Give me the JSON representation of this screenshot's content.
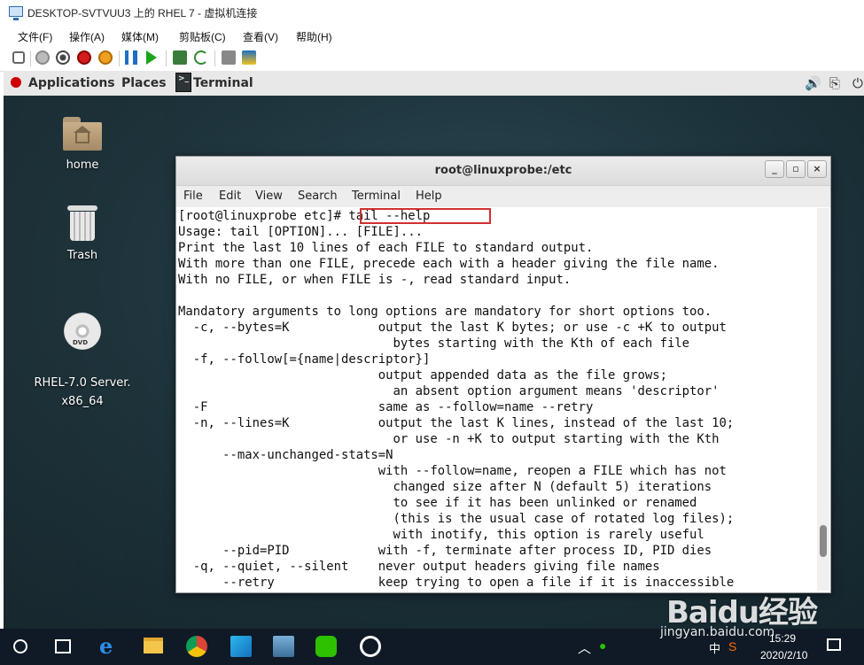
{
  "vm_window": {
    "title": "DESKTOP-SVTVUU3 上的 RHEL 7 - 虚拟机连接",
    "menu": [
      "文件(F)",
      "操作(A)",
      "媒体(M)",
      "剪贴板(C)",
      "查看(V)",
      "帮助(H)"
    ]
  },
  "gnome": {
    "applications": "Applications",
    "places": "Places",
    "task": "Terminal",
    "icons": [
      "volume-icon",
      "network-icon",
      "power-icon"
    ]
  },
  "desktop_icons": [
    {
      "label": "home",
      "icon": "home-folder-icon"
    },
    {
      "label": "Trash",
      "icon": "trash-icon"
    },
    {
      "label": "RHEL-7.0 Server.\nx86_64",
      "icon": "dvd-icon"
    }
  ],
  "terminal": {
    "title": "root@linuxprobe:/etc",
    "menu": [
      "File",
      "Edit",
      "View",
      "Search",
      "Terminal",
      "Help"
    ],
    "lines": [
      "[root@linuxprobe etc]# tail --help",
      "Usage: tail [OPTION]... [FILE]...",
      "Print the last 10 lines of each FILE to standard output.",
      "With more than one FILE, precede each with a header giving the file name.",
      "With no FILE, or when FILE is -, read standard input.",
      "",
      "Mandatory arguments to long options are mandatory for short options too.",
      "  -c, --bytes=K            output the last K bytes; or use -c +K to output",
      "                             bytes starting with the Kth of each file",
      "  -f, --follow[={name|descriptor}]",
      "                           output appended data as the file grows;",
      "                             an absent option argument means 'descriptor'",
      "  -F                       same as --follow=name --retry",
      "  -n, --lines=K            output the last K lines, instead of the last 10;",
      "                             or use -n +K to output starting with the Kth",
      "      --max-unchanged-stats=N",
      "                           with --follow=name, reopen a FILE which has not",
      "                             changed size after N (default 5) iterations",
      "                             to see if it has been unlinked or renamed",
      "                             (this is the usual case of rotated log files);",
      "                             with inotify, this option is rarely useful",
      "      --pid=PID            with -f, terminate after process ID, PID dies",
      "  -q, --quiet, --silent    never output headers giving file names",
      "      --retry              keep trying to open a file if it is inaccessible"
    ]
  },
  "taskbar": {
    "time": "15:29",
    "date": "2020/2/10",
    "ime": "中"
  },
  "watermark": {
    "brand": "Baidu经验",
    "url": "jingyan.baidu.com"
  }
}
